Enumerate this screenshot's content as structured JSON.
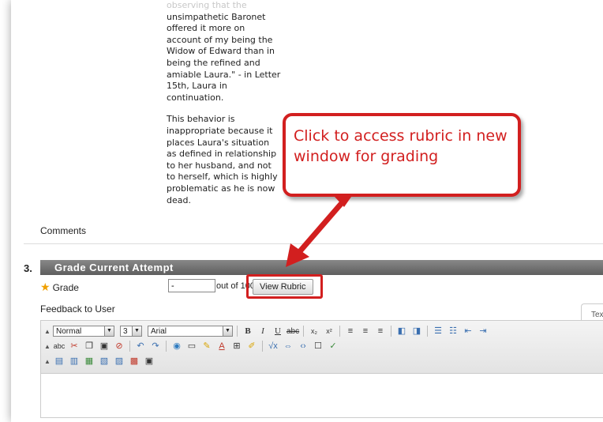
{
  "passage": {
    "fade_line": "observing that the",
    "p1": "unsimpathetic Baronet offered it more on account of my being the Widow of Edward than in being the refined and amiable Laura.\" - in Letter 15th, Laura in continuation.",
    "p2": "This behavior is inappropriate because it places Laura's situation as defined in relationship to her husband, and not to herself, which is highly problematic as he is now dead."
  },
  "comments_label": "Comments",
  "question": {
    "number": "3.",
    "section_title": "Grade Current Attempt",
    "grade_label": "Grade",
    "grade_value": "-",
    "out_of": "out of 100",
    "view_rubric_label": "View Rubric"
  },
  "feedback": {
    "label": "Feedback to User",
    "side_tab": "Tex"
  },
  "toolbar": {
    "format_select": "Normal",
    "size_select": "3",
    "font_select": "Arial"
  },
  "callout_text": "Click to access rubric in new window for grading",
  "colors": {
    "callout_red": "#d21f1f",
    "section_bar": "#6e6e6e"
  }
}
